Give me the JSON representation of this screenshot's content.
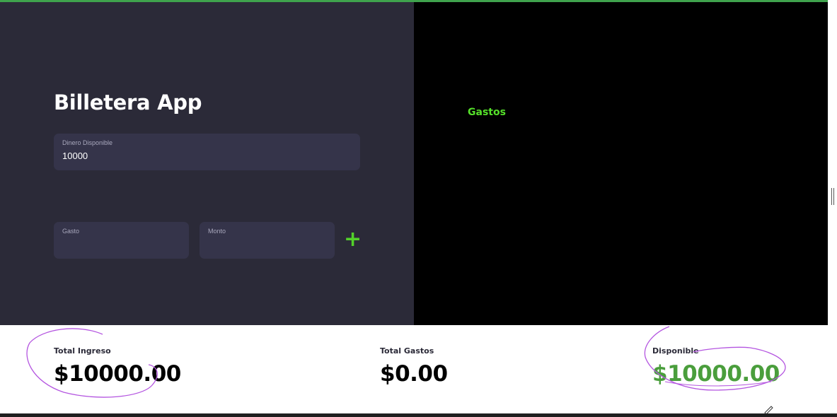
{
  "app": {
    "title": "Billetera App"
  },
  "form": {
    "dinero_label": "Dinero Disponible",
    "dinero_value": "10000",
    "gasto_label": "Gasto",
    "gasto_value": "",
    "monto_label": "Monto",
    "monto_value": "",
    "add_label": "+"
  },
  "gastos": {
    "title": "Gastos"
  },
  "summary": {
    "ingreso_label": "Total Ingreso",
    "ingreso_value": "$10000.00",
    "gastos_label": "Total Gastos",
    "gastos_value": "$0.00",
    "disponible_label": "Disponible",
    "disponible_value": "$10000.00"
  },
  "colors": {
    "accent_green": "#53d12a",
    "available_green": "#4a9e3c",
    "left_panel_bg": "#2b2a38",
    "input_bg": "#35344a",
    "annotation": "#b455e0"
  },
  "icons": {
    "add": "plus-icon",
    "annotation_tool": "pen-icon"
  }
}
